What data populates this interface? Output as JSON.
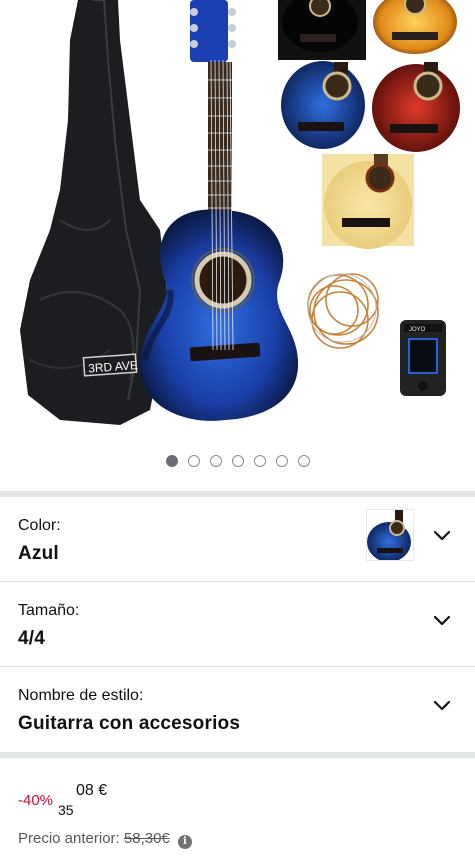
{
  "gallery": {
    "image_count": 7,
    "active_index": 0,
    "main_image_icon": "guitar-bundle-product-image"
  },
  "variations": [
    {
      "label": "Color:",
      "value": "Azul",
      "has_thumbnail": true
    },
    {
      "label": "Tamaño:",
      "value": "4/4",
      "has_thumbnail": false
    },
    {
      "label": "Nombre de estilo:",
      "value": "Guitarra con accesorios",
      "has_thumbnail": false
    }
  ],
  "price": {
    "discount": "-40%",
    "top": "08 €",
    "bottom": "35"
  },
  "previous_price": {
    "label": "Precio anterior:",
    "value": "58,30€",
    "info_icon": "i"
  },
  "colors": {
    "discount_red": "#cc0c39",
    "text": "#0f1111",
    "muted": "#565959",
    "separator": "#e3e6e6"
  }
}
